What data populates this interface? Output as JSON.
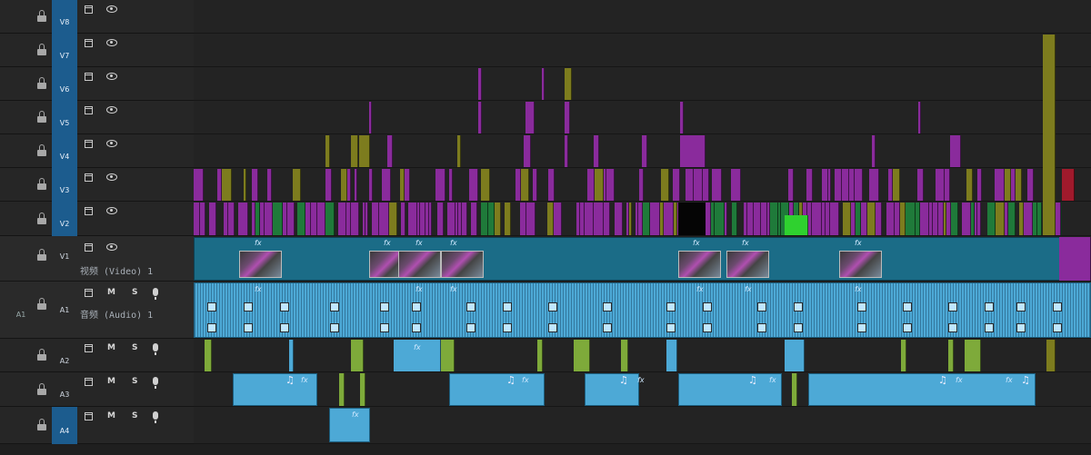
{
  "tracks": {
    "video": [
      {
        "id": "V8",
        "label": "V8"
      },
      {
        "id": "V7",
        "label": "V7"
      },
      {
        "id": "V6",
        "label": "V6"
      },
      {
        "id": "V5",
        "label": "V5"
      },
      {
        "id": "V4",
        "label": "V4"
      },
      {
        "id": "V3",
        "label": "V3"
      },
      {
        "id": "V2",
        "label": "V2"
      },
      {
        "id": "V1",
        "label": "V1",
        "name": "视频 (Video) 1",
        "source_patch": ""
      }
    ],
    "audio": [
      {
        "id": "A1",
        "label": "A1",
        "name": "音频 (Audio) 1",
        "source_patch": "A1"
      },
      {
        "id": "A2",
        "label": "A2"
      },
      {
        "id": "A3",
        "label": "A3"
      },
      {
        "id": "A4",
        "label": "A4"
      }
    ]
  },
  "buttons": {
    "mute": "M",
    "solo": "S"
  },
  "clip_badges": {
    "effect": "fx",
    "music": "♫"
  },
  "colors": {
    "purple": "#8a2b9c",
    "olive": "#7d7c1e",
    "green": "#1f7a3a",
    "bright_green": "#2fd12f",
    "teal": "#1b6c87",
    "audio_blue": "#4da9d6",
    "audio_green": "#7eaa3a",
    "red": "#a01a2c",
    "target_blue": "#1c5c8e"
  },
  "icons": {
    "lock": "lock-icon",
    "sync": "sync-lock-icon",
    "eye": "eye-icon",
    "mic": "microphone-icon"
  }
}
